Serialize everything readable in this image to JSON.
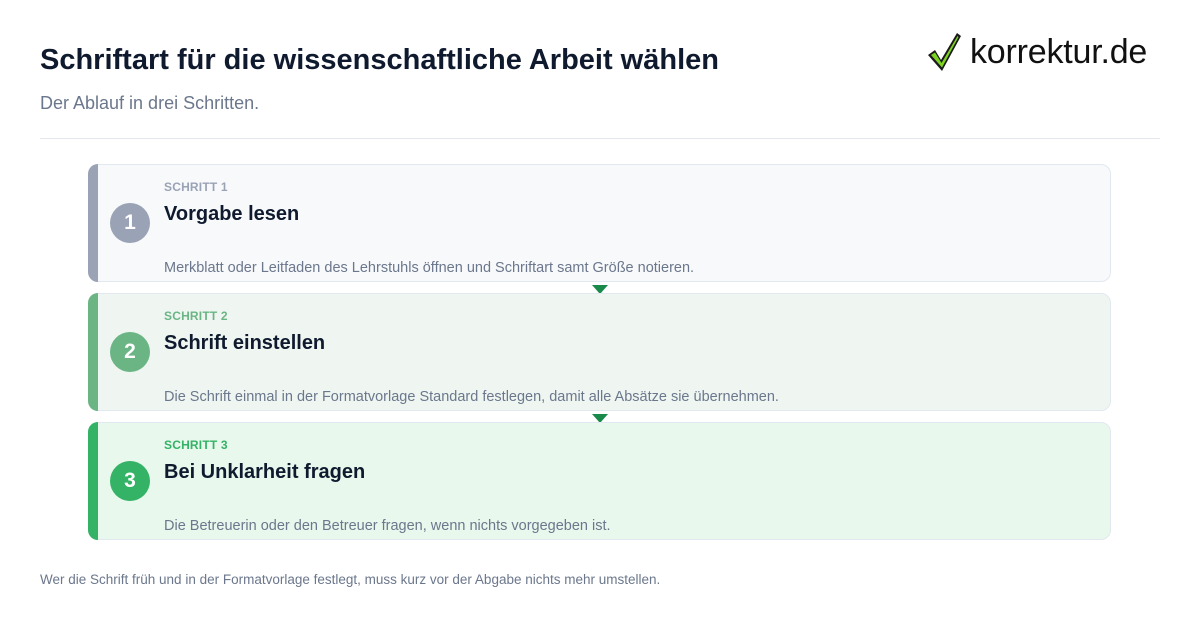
{
  "header": {
    "title": "Schriftart für die wissenschaftliche Arbeit wählen",
    "subtitle": "Der Ablauf in drei Schritten."
  },
  "logo": {
    "text": "korrektur.de",
    "icon": "checkmark-icon"
  },
  "steps": [
    {
      "number": "1",
      "kicker": "SCHRITT 1",
      "title": "Vorgabe lesen",
      "description": "Merkblatt oder Leitfaden des Lehrstuhls öffnen und Schriftart samt Größe notieren.",
      "accent": "#9aa3b5",
      "background": "#f8f9fb"
    },
    {
      "number": "2",
      "kicker": "SCHRITT 2",
      "title": "Schrift einstellen",
      "description": "Die Schrift einmal in der Formatvorlage Standard festlegen, damit alle Absätze sie übernehmen.",
      "accent": "#6bb585",
      "background": "#eff6f1"
    },
    {
      "number": "3",
      "kicker": "SCHRITT 3",
      "title": "Bei Unklarheit fragen",
      "description": "Die Betreuerin oder den Betreuer fragen, wenn nichts vorgegeben ist.",
      "accent": "#34b265",
      "background": "#e8f8ed"
    }
  ],
  "connector_color": "#1a8a4a",
  "footer": {
    "note": "Wer die Schrift früh und in der Formatvorlage festlegt, muss kurz vor der Abgabe nichts mehr umstellen."
  }
}
